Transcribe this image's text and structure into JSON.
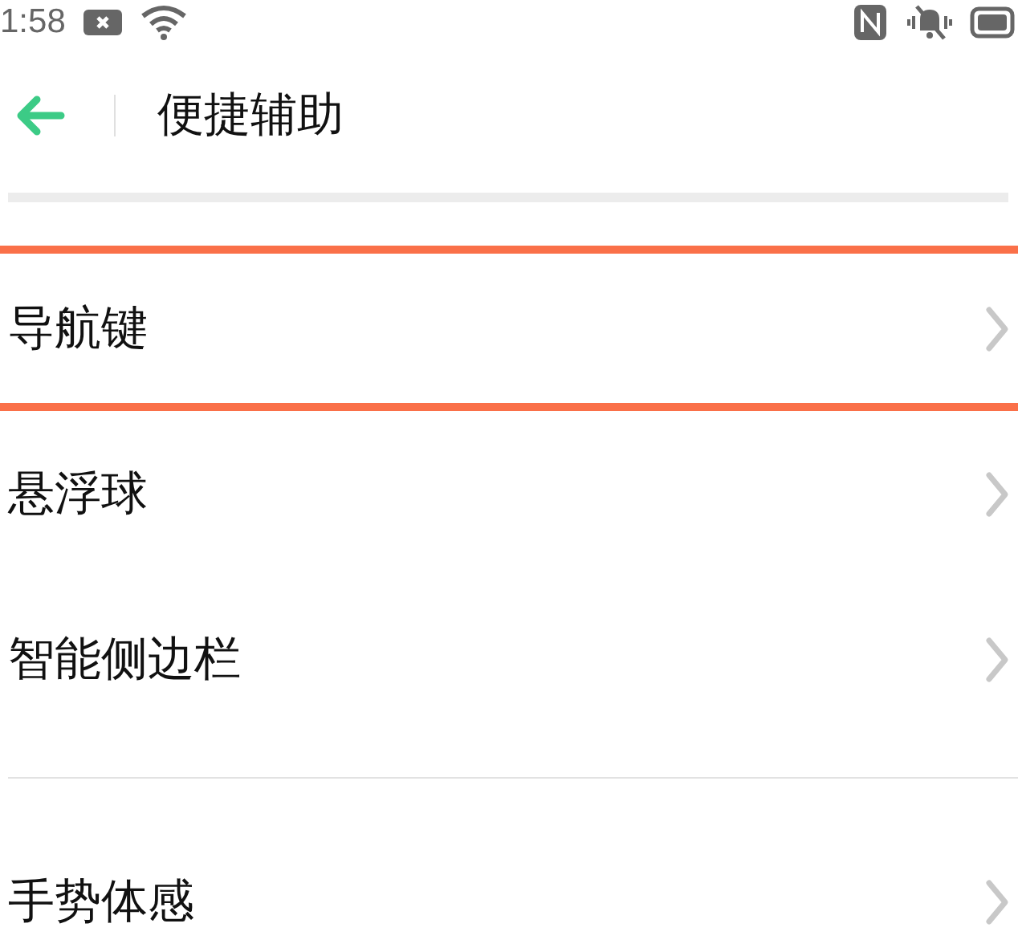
{
  "status_bar": {
    "time": "1:58"
  },
  "header": {
    "title": "便捷辅助"
  },
  "groups": [
    {
      "items": [
        {
          "label": "导航键",
          "highlighted": true
        },
        {
          "label": "悬浮球",
          "highlighted": false
        },
        {
          "label": "智能侧边栏",
          "highlighted": false
        }
      ]
    },
    {
      "items": [
        {
          "label": "手势体感",
          "highlighted": false
        }
      ]
    }
  ]
}
